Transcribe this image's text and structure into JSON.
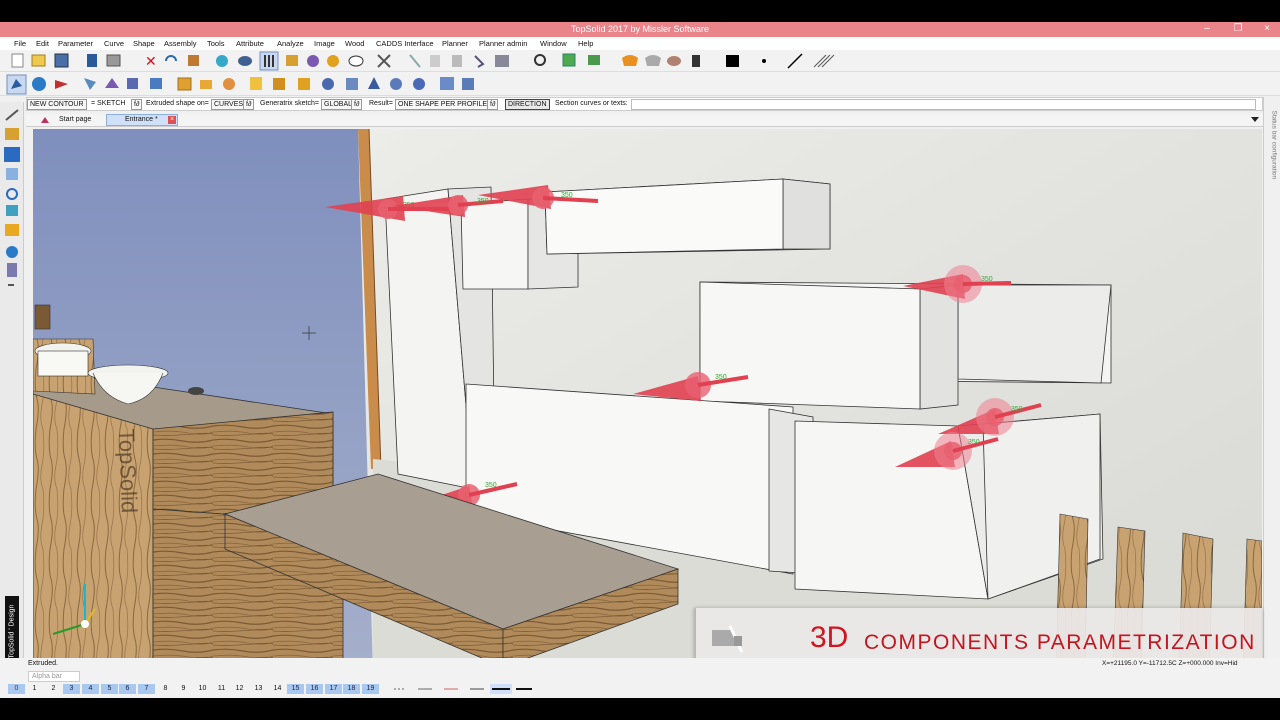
{
  "window": {
    "title": "TopSolid 2017 by Missler Software",
    "minimize": "–",
    "maximize": "❐",
    "close": "×"
  },
  "menu": [
    "File",
    "Edit",
    "Parameter",
    "Curve",
    "Shape",
    "Assembly",
    "Tools",
    "Attribute",
    "Analyze",
    "Image",
    "Wood",
    "CADDS Interface",
    "Planner",
    "Planner admin",
    "Window",
    "Help"
  ],
  "options_bar": {
    "new_contour": "NEW CONTOUR",
    "sketch_label": "= SKETCH",
    "sketch_icon": "f∂",
    "extruded_label": "Extruded shape on=",
    "extruded_value": "CURVES",
    "generatrix_label": "Generatrix sketch=",
    "generatrix_value": "GLOBAL",
    "result_label": "Result=",
    "result_value": "ONE SHAPE PER PROFILE",
    "direction": "DIRECTION",
    "section_label": "Section curves or texts:",
    "section_value": ""
  },
  "tabs": {
    "start_page": "Start page",
    "entrance": "Entrance *"
  },
  "right_panel": {
    "label": "Status bar configuration"
  },
  "brand": "TopSolid ' Design",
  "viewport": {
    "arrow_label": "350",
    "box_brand_text": "TopSolid"
  },
  "status": {
    "message": "Extruded.",
    "alpha_bar": "Alpha bar",
    "coords": "X=+21195.0  Y=-11712.5C  Z=+000.000  Inv=Hid"
  },
  "layers": [
    "0",
    "1",
    "2",
    "3",
    "4",
    "5",
    "6",
    "7",
    "8",
    "9",
    "10",
    "11",
    "12",
    "13",
    "14",
    "15",
    "16",
    "17",
    "18",
    "19"
  ],
  "banner": {
    "big": "3D",
    "rest": "COMPONENTS PARAMETRIZATION"
  },
  "colors": {
    "titlebar": "#e8848a",
    "accent_red": "#d2141e",
    "arrow_red": "#e04050",
    "wood": "#b08a5a",
    "sky": "#8fa0c8"
  }
}
